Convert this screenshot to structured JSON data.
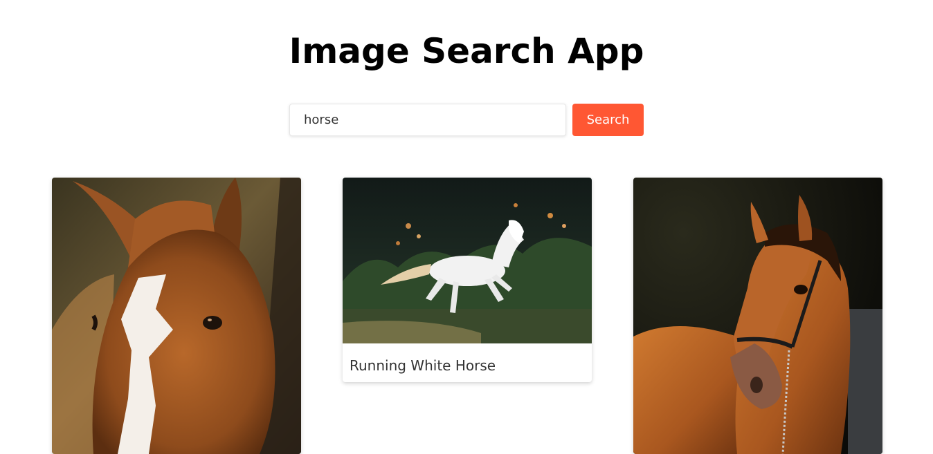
{
  "app": {
    "title": "Image Search App"
  },
  "search": {
    "value": "horse",
    "button_label": "Search"
  },
  "results": [
    {
      "caption": "",
      "subject": "chestnut horse head close-up with white blaze"
    },
    {
      "caption": "Running White Horse",
      "subject": "white horse galloping on dark grass"
    },
    {
      "caption": "",
      "subject": "bay horse wearing halter portrait"
    }
  ],
  "colors": {
    "accent": "#ff5733",
    "title": "#000000",
    "text": "#333333"
  }
}
